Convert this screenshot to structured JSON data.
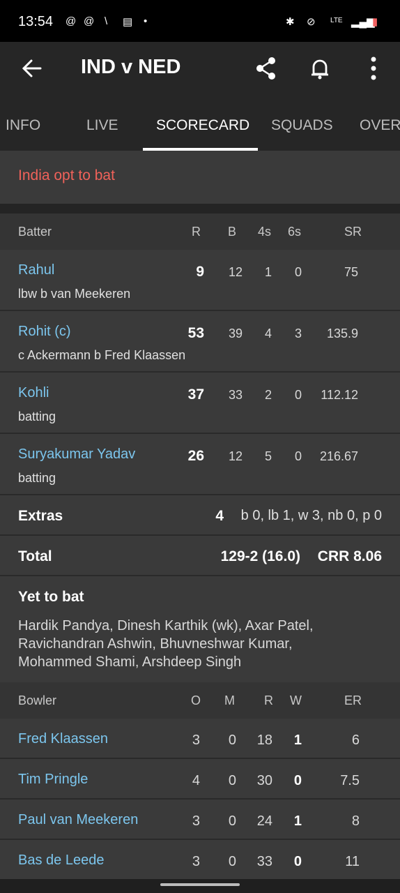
{
  "status_bar": {
    "time": "13:54",
    "network": "LTE"
  },
  "app_bar": {
    "title": "IND v NED"
  },
  "tabs": [
    "INFO",
    "LIVE",
    "SCORECARD",
    "SQUADS",
    "OVERS"
  ],
  "match_status": "India opt to bat",
  "batting_header": {
    "batter": "Batter",
    "r": "R",
    "b": "B",
    "fours": "4s",
    "sixes": "6s",
    "sr": "SR"
  },
  "batters": [
    {
      "name": "Rahul",
      "dismissal": "lbw b van Meekeren",
      "r": "9",
      "b": "12",
      "fours": "1",
      "sixes": "0",
      "sr": "75"
    },
    {
      "name": "Rohit (c)",
      "dismissal": "c Ackermann b Fred Klaassen",
      "r": "53",
      "b": "39",
      "fours": "4",
      "sixes": "3",
      "sr": "135.9"
    },
    {
      "name": "Kohli",
      "dismissal": "batting",
      "r": "37",
      "b": "33",
      "fours": "2",
      "sixes": "0",
      "sr": "112.12"
    },
    {
      "name": "Suryakumar Yadav",
      "dismissal": "batting",
      "r": "26",
      "b": "12",
      "fours": "5",
      "sixes": "0",
      "sr": "216.67"
    }
  ],
  "extras": {
    "label": "Extras",
    "total": "4",
    "detail": "b 0, lb 1, w 3, nb 0, p 0"
  },
  "total": {
    "label": "Total",
    "score": "129-2 (16.0)",
    "crr": "CRR 8.06"
  },
  "yet_to_bat": {
    "label": "Yet to bat",
    "line1": "Hardik Pandya, Dinesh Karthik (wk), Axar Patel,",
    "line2": "Ravichandran Ashwin, Bhuvneshwar Kumar,",
    "line3": "Mohammed Shami, Arshdeep Singh"
  },
  "bowling_header": {
    "bowler": "Bowler",
    "o": "O",
    "m": "M",
    "r": "R",
    "w": "W",
    "er": "ER"
  },
  "bowlers": [
    {
      "name": "Fred Klaassen",
      "o": "3",
      "m": "0",
      "r": "18",
      "w": "1",
      "er": "6"
    },
    {
      "name": "Tim Pringle",
      "o": "4",
      "m": "0",
      "r": "30",
      "w": "0",
      "er": "7.5"
    },
    {
      "name": "Paul van Meekeren",
      "o": "3",
      "m": "0",
      "r": "24",
      "w": "1",
      "er": "8"
    },
    {
      "name": "Bas de Leede",
      "o": "3",
      "m": "0",
      "r": "33",
      "w": "0",
      "er": "11"
    }
  ]
}
